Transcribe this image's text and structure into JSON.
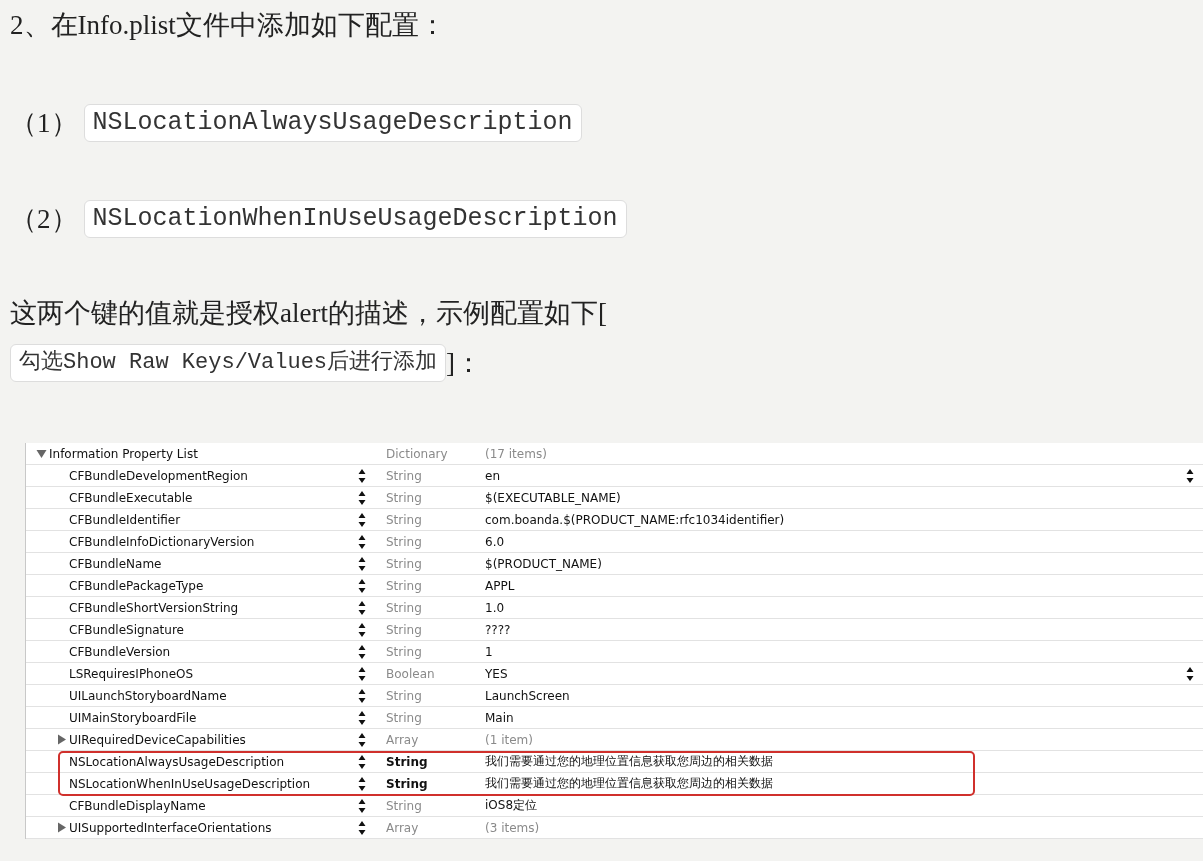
{
  "heading": "2、在Info.plist文件中添加如下配置：",
  "items": [
    {
      "number": "（1）",
      "code": "NSLocationAlwaysUsageDescription"
    },
    {
      "number": "（2）",
      "code": "NSLocationWhenInUseUsageDescription"
    }
  ],
  "note": {
    "text": "这两个键的值就是授权alert的描述，示例配置如下[",
    "code": "勾选Show Raw Keys/Values后进行添加",
    "tail": "]："
  },
  "plist": {
    "root": {
      "key": "Information Property List",
      "type": "Dictionary",
      "value": "(17 items)",
      "expanded": true
    },
    "rows": [
      {
        "key": "CFBundleDevelopmentRegion",
        "type": "String",
        "value": "en",
        "kind": "leaf",
        "popup": true,
        "highlighted": false
      },
      {
        "key": "CFBundleExecutable",
        "type": "String",
        "value": "$(EXECUTABLE_NAME)",
        "kind": "leaf",
        "popup": false,
        "highlighted": false
      },
      {
        "key": "CFBundleIdentifier",
        "type": "String",
        "value": "com.boanda.$(PRODUCT_NAME:rfc1034identifier)",
        "kind": "leaf",
        "popup": false,
        "highlighted": false
      },
      {
        "key": "CFBundleInfoDictionaryVersion",
        "type": "String",
        "value": "6.0",
        "kind": "leaf",
        "popup": false,
        "highlighted": false
      },
      {
        "key": "CFBundleName",
        "type": "String",
        "value": "$(PRODUCT_NAME)",
        "kind": "leaf",
        "popup": false,
        "highlighted": false
      },
      {
        "key": "CFBundlePackageType",
        "type": "String",
        "value": "APPL",
        "kind": "leaf",
        "popup": false,
        "highlighted": false
      },
      {
        "key": "CFBundleShortVersionString",
        "type": "String",
        "value": "1.0",
        "kind": "leaf",
        "popup": false,
        "highlighted": false
      },
      {
        "key": "CFBundleSignature",
        "type": "String",
        "value": "????",
        "kind": "leaf",
        "popup": false,
        "highlighted": false
      },
      {
        "key": "CFBundleVersion",
        "type": "String",
        "value": "1",
        "kind": "leaf",
        "popup": false,
        "highlighted": false
      },
      {
        "key": "LSRequiresIPhoneOS",
        "type": "Boolean",
        "value": "YES",
        "kind": "leaf",
        "popup": true,
        "highlighted": false
      },
      {
        "key": "UILaunchStoryboardName",
        "type": "String",
        "value": "LaunchScreen",
        "kind": "leaf",
        "popup": false,
        "highlighted": false
      },
      {
        "key": "UIMainStoryboardFile",
        "type": "String",
        "value": "Main",
        "kind": "leaf",
        "popup": false,
        "highlighted": false
      },
      {
        "key": "UIRequiredDeviceCapabilities",
        "type": "Array",
        "value": "(1 item)",
        "kind": "container",
        "expanded": false,
        "popup": false,
        "highlighted": false
      },
      {
        "key": "NSLocationAlwaysUsageDescription",
        "type": "String",
        "value": "我们需要通过您的地理位置信息获取您周边的相关数据",
        "kind": "leaf",
        "popup": false,
        "highlighted": true
      },
      {
        "key": "NSLocationWhenInUseUsageDescription",
        "type": "String",
        "value": "我们需要通过您的地理位置信息获取您周边的相关数据",
        "kind": "leaf",
        "popup": false,
        "highlighted": true
      },
      {
        "key": "CFBundleDisplayName",
        "type": "String",
        "value": "iOS8定位",
        "kind": "leaf",
        "popup": false,
        "highlighted": false
      },
      {
        "key": "UISupportedInterfaceOrientations",
        "type": "Array",
        "value": "(3 items)",
        "kind": "container",
        "expanded": false,
        "popup": false,
        "highlighted": false
      }
    ]
  }
}
